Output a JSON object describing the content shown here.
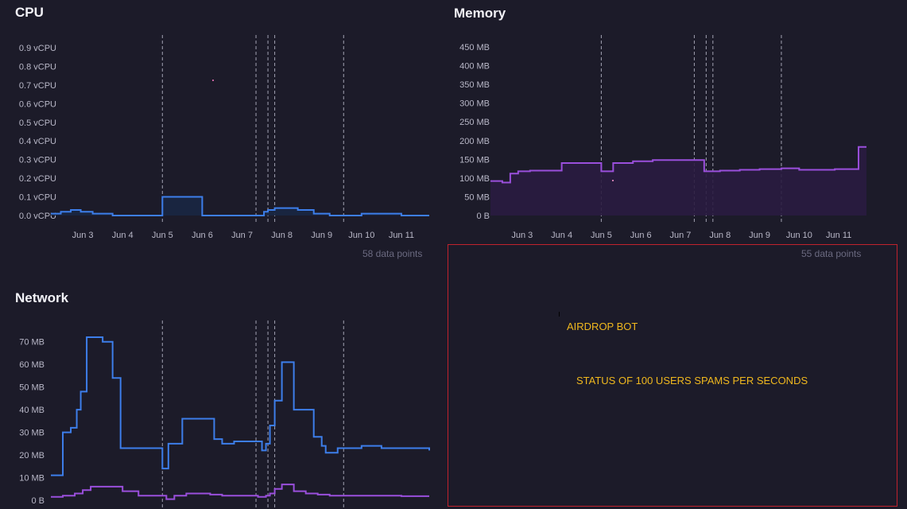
{
  "colors": {
    "background": "#1c1b29",
    "cpu": "#3d7eea",
    "net_in": "#3d7eea",
    "net_out": "#9a4fdc",
    "memory": "#9a4fdc",
    "annotation": "#f0b81e",
    "annotation_border": "#c0232d",
    "grid_marker": "#cfcfe0"
  },
  "cpu": {
    "title": "CPU",
    "points_label": "58 data points"
  },
  "memory": {
    "title": "Memory",
    "points_label": "55 data points"
  },
  "network": {
    "title": "Network"
  },
  "annotations": {
    "airdrop": "AIRDROP BOT",
    "status": "STATUS OF 100 USERS SPAMS PER SECONDS"
  },
  "chart_data": [
    {
      "id": "cpu",
      "type": "area",
      "title": "CPU",
      "ylim": [
        0,
        0.9
      ],
      "yticks": [
        "0.0 vCPU",
        "0.1 vCPU",
        "0.2 vCPU",
        "0.3 vCPU",
        "0.4 vCPU",
        "0.5 vCPU",
        "0.6 vCPU",
        "0.7 vCPU",
        "0.8 vCPU",
        "0.9 vCPU"
      ],
      "ytick_values": [
        0,
        0.1,
        0.2,
        0.3,
        0.4,
        0.5,
        0.6,
        0.7,
        0.8,
        0.9
      ],
      "xlim": [
        2.2,
        11.7
      ],
      "xticks": [
        "Jun 3",
        "Jun 4",
        "Jun 5",
        "Jun 6",
        "Jun 7",
        "Jun 8",
        "Jun 9",
        "Jun 10",
        "Jun 11"
      ],
      "xtick_values": [
        3,
        4,
        5,
        6,
        7,
        8,
        9,
        10,
        11
      ],
      "markers": [
        5.0,
        7.35,
        7.65,
        7.82,
        9.55
      ],
      "grid": false,
      "series": [
        {
          "name": "",
          "color": "#3d7eea",
          "fill": "#1a2742",
          "x": [
            2.2,
            2.45,
            2.7,
            2.95,
            3.25,
            3.75,
            4.0,
            4.3,
            4.6,
            4.9,
            5.0,
            5.2,
            5.9,
            6.0,
            6.5,
            7.0,
            7.35,
            7.55,
            7.65,
            7.82,
            8.1,
            8.4,
            8.8,
            9.2,
            9.55,
            10.0,
            10.5,
            11.0,
            11.4,
            11.7
          ],
          "y": [
            0.01,
            0.02,
            0.03,
            0.02,
            0.01,
            0.0,
            0.0,
            0.0,
            0.0,
            0.0,
            0.1,
            0.1,
            0.1,
            0.0,
            0.0,
            0.0,
            0.0,
            0.02,
            0.03,
            0.04,
            0.04,
            0.03,
            0.01,
            0.0,
            0.0,
            0.01,
            0.01,
            0.0,
            0.0,
            0.0
          ]
        }
      ]
    },
    {
      "id": "memory",
      "type": "area",
      "title": "Memory",
      "ylim": [
        0,
        450
      ],
      "yticks": [
        "0 B",
        "50 MB",
        "100 MB",
        "150 MB",
        "200 MB",
        "250 MB",
        "300 MB",
        "350 MB",
        "400 MB",
        "450 MB"
      ],
      "ytick_values": [
        0,
        50,
        100,
        150,
        200,
        250,
        300,
        350,
        400,
        450
      ],
      "xlim": [
        2.2,
        11.7
      ],
      "xticks": [
        "Jun 3",
        "Jun 4",
        "Jun 5",
        "Jun 6",
        "Jun 7",
        "Jun 8",
        "Jun 9",
        "Jun 10",
        "Jun 11"
      ],
      "xtick_values": [
        3,
        4,
        5,
        6,
        7,
        8,
        9,
        10,
        11
      ],
      "markers": [
        5.0,
        7.35,
        7.65,
        7.82,
        9.55
      ],
      "grid": false,
      "series": [
        {
          "name": "",
          "color": "#9a4fdc",
          "fill": "#2a1c40",
          "x": [
            2.2,
            2.5,
            2.7,
            2.9,
            3.2,
            3.6,
            4.0,
            4.5,
            4.75,
            5.0,
            5.3,
            5.8,
            6.3,
            6.8,
            7.2,
            7.6,
            8.0,
            8.5,
            9.0,
            9.55,
            10.0,
            10.5,
            10.9,
            11.2,
            11.5,
            11.7
          ],
          "y": [
            92,
            88,
            112,
            118,
            120,
            120,
            140,
            140,
            140,
            118,
            140,
            145,
            148,
            148,
            148,
            118,
            120,
            122,
            124,
            126,
            122,
            122,
            124,
            124,
            183,
            183
          ]
        }
      ]
    },
    {
      "id": "network",
      "type": "line",
      "title": "Network",
      "ylim": [
        0,
        72
      ],
      "yticks": [
        "0 B",
        "10 MB",
        "20 MB",
        "30 MB",
        "40 MB",
        "50 MB",
        "60 MB",
        "70 MB"
      ],
      "ytick_values": [
        0,
        10,
        20,
        30,
        40,
        50,
        60,
        70
      ],
      "xlim": [
        2.2,
        11.7
      ],
      "markers": [
        5.0,
        7.35,
        7.65,
        7.82,
        9.55
      ],
      "grid": false,
      "series": [
        {
          "name": "",
          "color": "#3d7eea",
          "x": [
            2.2,
            2.5,
            2.7,
            2.85,
            2.95,
            3.1,
            3.5,
            3.75,
            3.95,
            4.3,
            4.7,
            4.9,
            5.0,
            5.15,
            5.5,
            5.95,
            6.3,
            6.5,
            6.8,
            7.2,
            7.5,
            7.6,
            7.7,
            7.82,
            8.0,
            8.3,
            8.5,
            8.8,
            9.0,
            9.1,
            9.4,
            9.7,
            10.0,
            10.5,
            11.0,
            11.7
          ],
          "y": [
            11,
            30,
            32,
            40,
            48,
            72,
            70,
            54,
            23,
            23,
            23,
            23,
            14,
            25,
            36,
            36,
            27,
            25,
            26,
            26,
            22,
            25,
            33,
            44,
            61,
            40,
            40,
            28,
            24,
            21,
            23,
            23,
            24,
            23,
            23,
            22
          ]
        },
        {
          "name": "",
          "color": "#9a4fdc",
          "x": [
            2.2,
            2.5,
            2.8,
            3.0,
            3.2,
            3.4,
            3.6,
            4.0,
            4.4,
            4.8,
            5.0,
            5.1,
            5.3,
            5.6,
            5.9,
            6.2,
            6.5,
            6.8,
            7.1,
            7.4,
            7.6,
            7.7,
            7.82,
            8.0,
            8.3,
            8.6,
            8.9,
            9.2,
            9.55,
            10.0,
            10.5,
            11.0,
            11.7
          ],
          "y": [
            1.5,
            2,
            3,
            4.5,
            6,
            6,
            6,
            4,
            2,
            2,
            2,
            0.5,
            2,
            3,
            3,
            2.5,
            2,
            2,
            2,
            1.5,
            2,
            3,
            5,
            7,
            4,
            3,
            2.5,
            2,
            2,
            2,
            2,
            1.8,
            1.8
          ]
        }
      ]
    }
  ]
}
